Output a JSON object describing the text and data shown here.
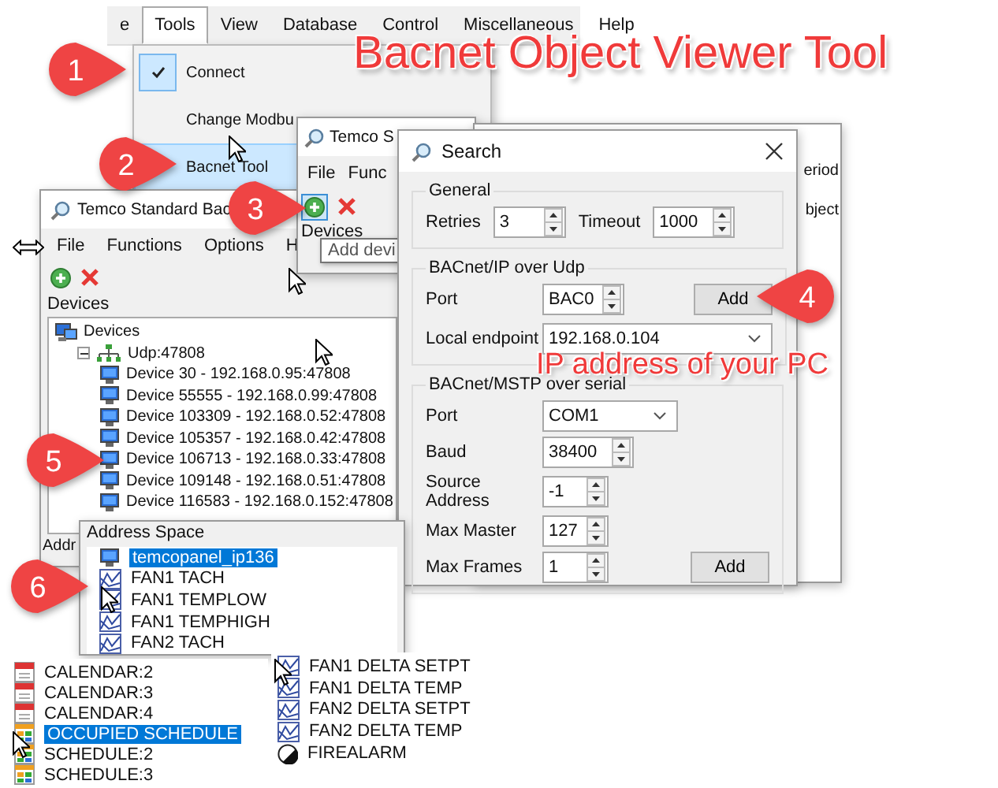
{
  "title": "Bacnet Object Viewer Tool",
  "menu_bar": {
    "items": [
      {
        "label": "e",
        "selected": false
      },
      {
        "label": "Tools",
        "selected": true
      },
      {
        "label": "View",
        "selected": false
      },
      {
        "label": "Database",
        "selected": false
      },
      {
        "label": "Control",
        "selected": false
      },
      {
        "label": "Miscellaneous",
        "selected": false
      },
      {
        "label": "Help",
        "selected": false
      }
    ]
  },
  "tools_menu": {
    "items": [
      {
        "label": "Connect",
        "checked": true,
        "selected": false
      },
      {
        "label": "Change Modbu",
        "checked": false,
        "selected": false
      },
      {
        "label": "Bacnet Tool",
        "checked": false,
        "selected": true
      }
    ]
  },
  "main_window": {
    "title": "Temco Standard Bac",
    "menu": [
      "File",
      "Functions",
      "Options",
      "H"
    ],
    "panel_label": "Devices",
    "tree": {
      "label": "Devices",
      "kind": "root",
      "children": [
        {
          "label": "Udp:47808",
          "kind": "network",
          "expanded": true,
          "children": [
            {
              "label": "Device 30 - 192.168.0.95:47808",
              "kind": "device"
            },
            {
              "label": "Device 55555 - 192.168.0.99:47808",
              "kind": "device"
            },
            {
              "label": "Device 103309 - 192.168.0.52:47808",
              "kind": "device"
            },
            {
              "label": "Device 105357 - 192.168.0.42:47808",
              "kind": "device"
            },
            {
              "label": "Device 106713 - 192.168.0.33:47808",
              "kind": "device"
            },
            {
              "label": "Device 109148 - 192.168.0.51:47808",
              "kind": "device"
            },
            {
              "label": "Device 116583 - 192.168.0.152:47808",
              "kind": "device"
            }
          ]
        }
      ]
    },
    "bottom_label": "Addr"
  },
  "small_window": {
    "title": "Temco S",
    "menu": [
      "File",
      "Func"
    ],
    "panel_label": "Devices",
    "tooltip": "Add devi"
  },
  "background_window": {
    "texts": [
      "eriod",
      "bject"
    ]
  },
  "search_dialog": {
    "title": "Search",
    "general": {
      "heading": "General",
      "fields": [
        {
          "label": "Retries",
          "value": "3"
        },
        {
          "label": "Timeout",
          "value": "1000"
        }
      ]
    },
    "ip": {
      "heading": "BACnet/IP over Udp",
      "port_label": "Port",
      "port_value": "BAC0",
      "add_button": "Add",
      "endpoint_label": "Local endpoint",
      "endpoint_value": "192.168.0.104"
    },
    "mstp": {
      "heading": "BACnet/MSTP over serial",
      "fields": [
        {
          "label": "Port",
          "value": "COM1",
          "kind": "dropdown"
        },
        {
          "label": "Baud",
          "value": "38400",
          "kind": "spinner"
        },
        {
          "label": "Source Address",
          "value": "-1",
          "kind": "spinner"
        },
        {
          "label": "Max Master",
          "value": "127",
          "kind": "spinner"
        },
        {
          "label": "Max Frames",
          "value": "1",
          "kind": "spinner"
        }
      ],
      "add_button": "Add"
    }
  },
  "address_space": {
    "title": "Address Space",
    "items": [
      {
        "label": "temcopanel_ip136",
        "kind": "device",
        "selected": true
      },
      {
        "label": "FAN1 TACH",
        "kind": "analog",
        "selected": false
      },
      {
        "label": "FAN1 TEMPLOW",
        "kind": "analog",
        "selected": false
      },
      {
        "label": "FAN1 TEMPHIGH",
        "kind": "analog",
        "selected": false
      },
      {
        "label": "FAN2 TACH",
        "kind": "analog",
        "selected": false
      }
    ]
  },
  "object_list_left": {
    "items": [
      {
        "label": "CALENDAR:2",
        "kind": "calendar",
        "selected": false
      },
      {
        "label": "CALENDAR:3",
        "kind": "calendar",
        "selected": false
      },
      {
        "label": "CALENDAR:4",
        "kind": "calendar",
        "selected": false
      },
      {
        "label": "OCCUPIED SCHEDULE",
        "kind": "schedule",
        "selected": true
      },
      {
        "label": "SCHEDULE:2",
        "kind": "schedule",
        "selected": false
      },
      {
        "label": "SCHEDULE:3",
        "kind": "schedule",
        "selected": false
      }
    ]
  },
  "object_list_right": {
    "items": [
      {
        "label": "FAN1 DELTA SETPT",
        "kind": "analog",
        "selected": false
      },
      {
        "label": "FAN1 DELTA TEMP",
        "kind": "analog",
        "selected": false
      },
      {
        "label": "FAN2 DELTA SETPT",
        "kind": "analog",
        "selected": false
      },
      {
        "label": "FAN2 DELTA TEMP",
        "kind": "analog",
        "selected": false
      },
      {
        "label": "FIREALARM",
        "kind": "binary",
        "selected": false
      }
    ]
  },
  "annotation": "IP address of your PC",
  "callouts": [
    {
      "number": "1"
    },
    {
      "number": "2"
    },
    {
      "number": "3"
    },
    {
      "number": "4"
    },
    {
      "number": "5"
    },
    {
      "number": "6"
    }
  ]
}
